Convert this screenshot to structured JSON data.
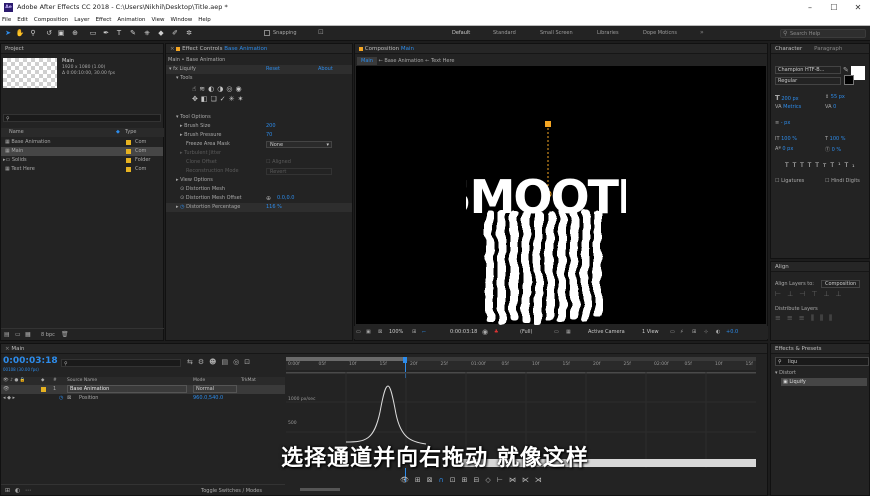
{
  "window": {
    "title": "Adobe After Effects CC 2018 - C:\\Users\\Nikhil\\Desktop\\Title.aep *",
    "app_icon": "Ae"
  },
  "menu": [
    "File",
    "Edit",
    "Composition",
    "Layer",
    "Effect",
    "Animation",
    "View",
    "Window",
    "Help"
  ],
  "toolbar": {
    "snapping": "Snapping",
    "workspaces": [
      "Default",
      "Standard",
      "Small Screen",
      "Libraries",
      "Dope Moticns"
    ],
    "search_placeholder": "Search Help"
  },
  "project": {
    "title": "Project",
    "preview": {
      "name": "Main",
      "info1": "1920 x 1080 (1.00)",
      "info2": "Δ 0:00:10:00, 30.00 fps"
    },
    "columns": {
      "name": "Name",
      "type": "Type"
    },
    "items": [
      {
        "name": "Base Animation",
        "type": "Com"
      },
      {
        "name": "Main",
        "type": "Com"
      },
      {
        "name": "Solids",
        "type": "Folder"
      },
      {
        "name": "Text Here",
        "type": "Com"
      }
    ],
    "bpc": "8 bpc"
  },
  "effect_controls": {
    "title": "Effect Controls",
    "layer": "Base Animation",
    "path": "Main • Base Animation",
    "effect": {
      "name": "Liquify",
      "reset": "Reset",
      "about": "About"
    },
    "tools_label": "Tools",
    "tool_options": "Tool Options",
    "props": [
      {
        "name": "Brush Size",
        "value": "200"
      },
      {
        "name": "Brush Pressure",
        "value": "70"
      },
      {
        "name": "Freeze Area Mask",
        "value": "None"
      },
      {
        "name": "Turbulent Jitter",
        "value": ""
      },
      {
        "name": "Clone Offset",
        "value": "Aligned"
      },
      {
        "name": "Reconstruction Mode",
        "value": "Revert"
      }
    ],
    "view_options": "View Options",
    "distortion_mesh": "Distortion Mesh",
    "mesh_offset": {
      "name": "Distortion Mesh Offset",
      "value": "0.0,0.0"
    },
    "percentage": {
      "name": "Distortion Percentage",
      "value": "116 %"
    }
  },
  "composition": {
    "title": "Composition",
    "name": "Main",
    "breadcrumbs": [
      "Main",
      "Base Animation",
      "Text Here"
    ],
    "artwork_text": "SMOOTH",
    "zoom": "100%",
    "timecode": "0:00:03:18",
    "resolution": "(Full)",
    "camera": "Active Camera",
    "view": "1 View",
    "offset": "+0.0"
  },
  "character": {
    "tabs": [
      "Character",
      "Paragraph"
    ],
    "font": "Champion HTF-B...",
    "style": "Regular",
    "size": "200 px",
    "leading": "55 px",
    "kerning": "Metrics",
    "tracking": "0",
    "stroke": "- px",
    "vscale": "100 %",
    "hscale": "100 %",
    "baseline": "0 px",
    "tsume": "0 %",
    "ligatures": "Ligatures",
    "hindi": "Hindi Digits"
  },
  "align": {
    "title": "Align",
    "align_to_label": "Align Layers to:",
    "align_to": "Composition",
    "distribute": "Distribute Layers"
  },
  "effects_presets": {
    "title": "Effects & Presets",
    "query": "liqu",
    "category": "Distort",
    "item": "Liquify"
  },
  "timeline": {
    "tab": "Main",
    "timecode": "0:00:03:18",
    "frames": "00108 (30.00 fps)",
    "cols": {
      "source": "Source Name",
      "mode": "Mode",
      "trkmat": "TrkMat"
    },
    "layers": [
      {
        "num": "1",
        "name": "Base Animation",
        "mode": "Normal"
      },
      {
        "name": "Position",
        "value": "960.0,540.0"
      }
    ],
    "ruler": [
      "0:00f",
      "05f",
      "10f",
      "15f",
      "20f",
      "25f",
      "01:00f",
      "05f",
      "10f",
      "15f",
      "20f",
      "25f",
      "02:00f",
      "05f",
      "10f",
      "15f"
    ],
    "graph_labels": [
      "1000 px/sec",
      "500"
    ],
    "toggle": "Toggle Switches / Modes"
  },
  "subtitle": "选择通道并向右拖动 就像这样",
  "colors": {
    "accent": "#2d8ceb",
    "label_yellow": "#e6b221",
    "panel": "#232323",
    "highlight": "#f5a623"
  }
}
